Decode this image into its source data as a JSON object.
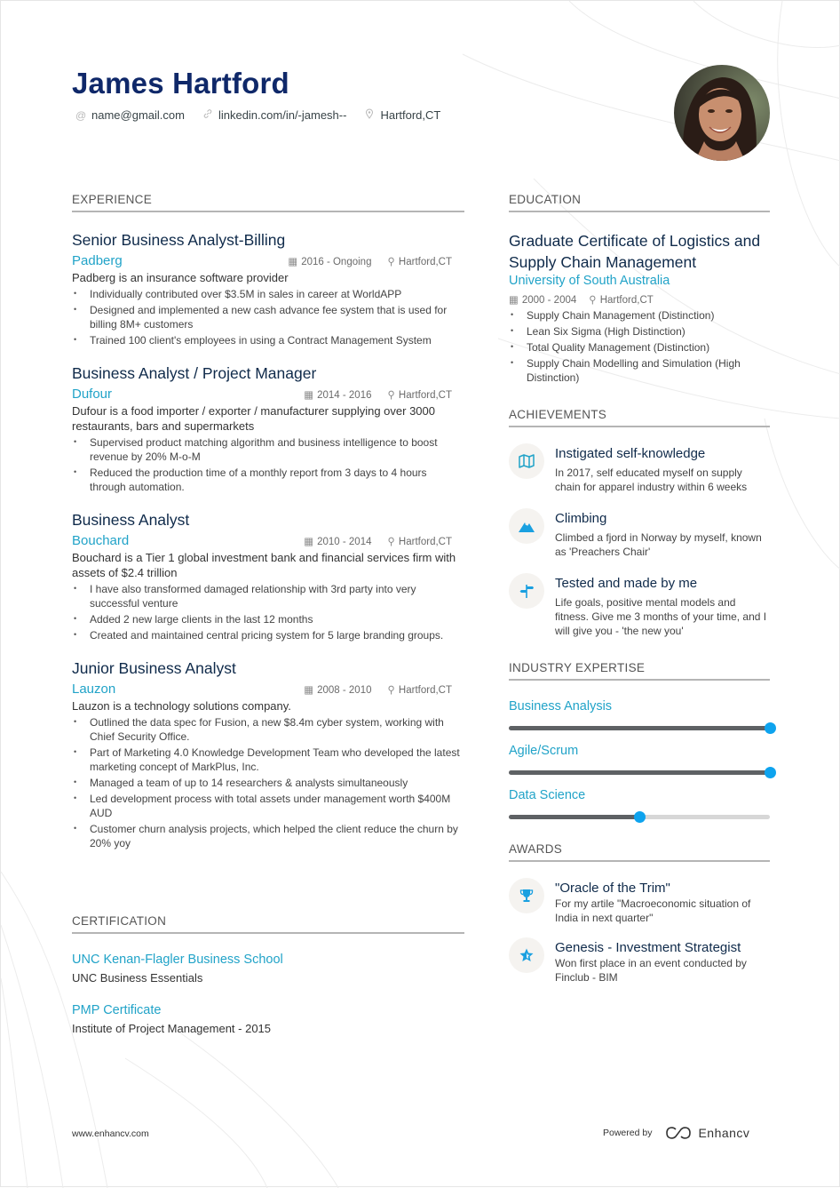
{
  "header": {
    "name": "James Hartford",
    "contacts": [
      {
        "icon": "at-icon",
        "text": "name@gmail.com"
      },
      {
        "icon": "link-icon",
        "text": "linkedin.com/in/-jamesh--"
      },
      {
        "icon": "location-pin-icon",
        "text": "Hartford,CT"
      }
    ]
  },
  "experience": {
    "title": "EXPERIENCE",
    "jobs": [
      {
        "title": "Senior Business Analyst-Billing",
        "company": "Padberg",
        "dates": "2016 - Ongoing",
        "location": "Hartford,CT",
        "description": "Padberg is an insurance software provider",
        "bullets": [
          "Individually contributed over $3.5M in sales in career at WorldAPP",
          "Designed and implemented a new cash advance fee system that is used for billing 8M+ customers",
          "Trained 100 client's employees in using a Contract Management System"
        ]
      },
      {
        "title": "Business Analyst / Project Manager",
        "company": "Dufour",
        "dates": "2014 - 2016",
        "location": "Hartford,CT",
        "description": "Dufour is a food importer / exporter / manufacturer supplying over 3000 restaurants, bars and supermarkets",
        "bullets": [
          "Supervised product matching algorithm and business intelligence to boost revenue by 20% M-o-M",
          "Reduced the production time of a monthly report from 3 days to 4 hours through automation."
        ]
      },
      {
        "title": "Business Analyst",
        "company": "Bouchard",
        "dates": "2010 - 2014",
        "location": "Hartford,CT",
        "description": "Bouchard is a Tier 1 global investment bank and financial services firm with assets of $2.4 trillion",
        "bullets": [
          "I have also transformed damaged relationship with 3rd party into very successful venture",
          "Added 2 new large clients in the last 12 months",
          "Created and maintained central pricing system for 5 large branding groups."
        ]
      },
      {
        "title": "Junior Business Analyst",
        "company": "Lauzon",
        "dates": "2008 - 2010",
        "location": "Hartford,CT",
        "description": "Lauzon is a technology solutions company.",
        "bullets": [
          "Outlined the data spec for Fusion, a new $8.4m cyber system, working with Chief Security Office.",
          "Part of Marketing 4.0 Knowledge Development Team who developed the latest marketing concept of MarkPlus, Inc.",
          "Managed a team of up to 14 researchers & analysts simultaneously",
          "Led development process with total assets under management worth $400M AUD",
          "Customer churn analysis projects, which helped the client reduce the churn by 20% yoy"
        ]
      }
    ]
  },
  "certification": {
    "title": "CERTIFICATION",
    "items": [
      {
        "name": "UNC Kenan-Flagler Business School",
        "sub": "UNC Business Essentials"
      },
      {
        "name": "PMP Certificate",
        "sub": "Institute of Project Management - 2015"
      }
    ]
  },
  "education": {
    "title": "EDUCATION",
    "degree": "Graduate Certificate of Logistics and Supply Chain Management",
    "school": "University of South Australia",
    "dates": "2000 - 2004",
    "location": "Hartford,CT",
    "bullets": [
      "Supply Chain Management (Distinction)",
      "Lean Six Sigma (High Distinction)",
      "Total Quality Management (Distinction)",
      "Supply Chain Modelling and Simulation (High Distinction)"
    ]
  },
  "achievements": {
    "title": "ACHIEVEMENTS",
    "items": [
      {
        "icon": "map-icon",
        "title": "Instigated self-knowledge",
        "desc": "In 2017, self educated myself on supply chain for apparel industry within 6 weeks"
      },
      {
        "icon": "mountain-icon",
        "title": "Climbing",
        "desc": "Climbed a fjord in Norway by myself, known as 'Preachers Chair'"
      },
      {
        "icon": "signpost-icon",
        "title": "Tested and made by me",
        "desc": "Life goals, positive mental models and fitness. Give me 3 months of your time, and I will give you - 'the new you'"
      }
    ]
  },
  "expertise": {
    "title": "INDUSTRY EXPERTISE",
    "skills": [
      {
        "name": "Business Analysis",
        "level": 1.0
      },
      {
        "name": "Agile/Scrum",
        "level": 1.0
      },
      {
        "name": "Data Science",
        "level": 0.5
      }
    ]
  },
  "awards": {
    "title": "AWARDS",
    "items": [
      {
        "icon": "trophy-icon",
        "title": "\"Oracle of the Trim\"",
        "desc": "For my artile \"Macroeconomic situation of India in next quarter\""
      },
      {
        "icon": "star-icon",
        "title": "Genesis - Investment Strategist",
        "desc": "Won first place in an event conducted by Finclub - BIM"
      }
    ]
  },
  "footer": {
    "website": "www.enhancv.com",
    "powered_by": "Powered by",
    "brand": "Enhancv"
  },
  "colors": {
    "name": "#0f2869",
    "accent": "#21a3c8",
    "slider_knob": "#0ea3ee",
    "slider_fill": "#5e6164"
  }
}
